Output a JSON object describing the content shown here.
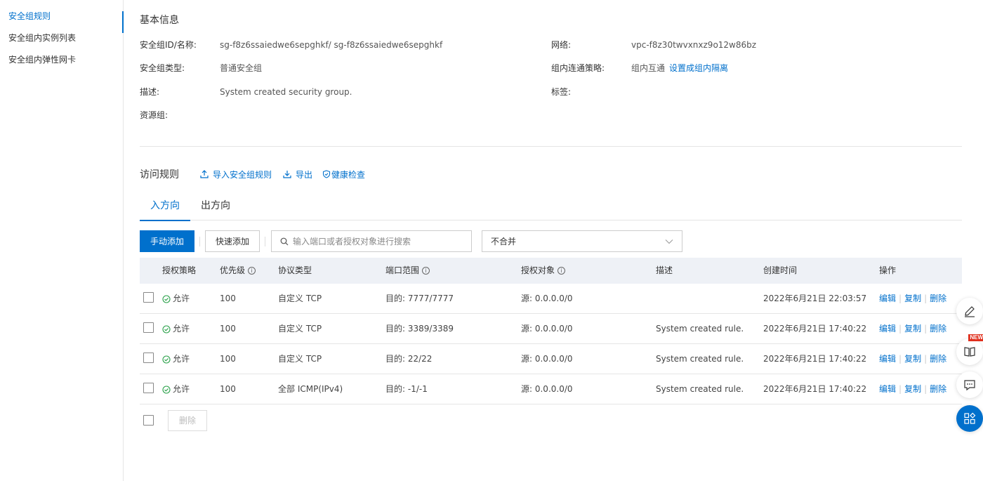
{
  "sidebar": {
    "items": [
      {
        "label": "安全组规则"
      },
      {
        "label": "安全组内实例列表"
      },
      {
        "label": "安全组内弹性网卡"
      }
    ]
  },
  "basic_info": {
    "title": "基本信息",
    "sg_id_label": "安全组ID/名称:",
    "sg_id_value": "sg-f8z6ssaiedwe6sepghkf/ sg-f8z6ssaiedwe6sepghkf",
    "network_label": "网络:",
    "network_value": "vpc-f8z30twvxnxz9o12w86bz",
    "sg_type_label": "安全组类型:",
    "sg_type_value": "普通安全组",
    "intra_policy_label": "组内连通策略:",
    "intra_policy_value": "组内互通",
    "intra_policy_link": "设置成组内隔离",
    "desc_label": "描述:",
    "desc_value": "System created security group.",
    "tags_label": "标签:",
    "resource_group_label": "资源组:"
  },
  "rules": {
    "title": "访问规则",
    "actions": {
      "import": "导入安全组规则",
      "export": "导出",
      "health": "健康检查"
    },
    "tabs": [
      {
        "label": "入方向"
      },
      {
        "label": "出方向"
      }
    ],
    "toolbar": {
      "manual_add": "手动添加",
      "quick_add": "快速添加",
      "search_placeholder": "输入端口或者授权对象进行搜索",
      "merge_select": "不合并"
    },
    "columns": {
      "policy": "授权策略",
      "priority": "优先级",
      "protocol": "协议类型",
      "port": "端口范围",
      "target": "授权对象",
      "desc": "描述",
      "created": "创建时间",
      "ops": "操作"
    },
    "rows": [
      {
        "policy": "允许",
        "priority": "100",
        "protocol": "自定义 TCP",
        "port": "目的: 7777/7777",
        "target": "源: 0.0.0.0/0",
        "desc": "",
        "created": "2022年6月21日 22:03:57"
      },
      {
        "policy": "允许",
        "priority": "100",
        "protocol": "自定义 TCP",
        "port": "目的: 3389/3389",
        "target": "源: 0.0.0.0/0",
        "desc": "System created rule.",
        "created": "2022年6月21日 17:40:22"
      },
      {
        "policy": "允许",
        "priority": "100",
        "protocol": "自定义 TCP",
        "port": "目的: 22/22",
        "target": "源: 0.0.0.0/0",
        "desc": "System created rule.",
        "created": "2022年6月21日 17:40:22"
      },
      {
        "policy": "允许",
        "priority": "100",
        "protocol": "全部 ICMP(IPv4)",
        "port": "目的: -1/-1",
        "target": "源: 0.0.0.0/0",
        "desc": "System created rule.",
        "created": "2022年6月21日 17:40:22"
      }
    ],
    "op_labels": {
      "edit": "编辑",
      "copy": "复制",
      "delete": "删除"
    },
    "bulk_delete": "删除"
  },
  "float_tools": {
    "new_badge": "NEW"
  },
  "colors": {
    "accent": "#0070cc",
    "allow_green": "#2aa14a",
    "table_header_bg": "#eef1f6"
  }
}
